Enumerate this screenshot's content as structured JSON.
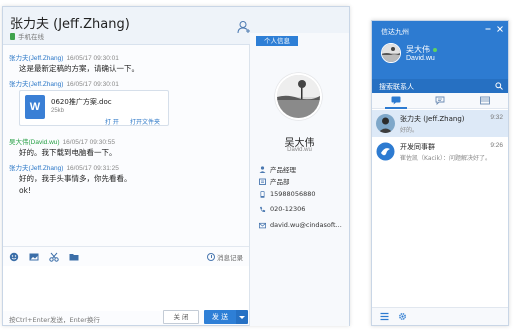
{
  "chat": {
    "contact_name": "张力夫 (Jeff.Zhang)",
    "contact_status": "手机在线",
    "profile_tab": "个人信息",
    "messages": [
      {
        "sender": "张力夫(Jeff.Zhang)",
        "time": "16/05/17 09:30:01",
        "text": "这是最新定稿的方案，请确认一下。"
      },
      {
        "sender": "张力夫(Jeff.Zhang)",
        "time": "16/05/17 09:30:01"
      },
      {
        "sender": "吴大伟(David.wu)",
        "time": "16/05/17 09:30:55",
        "text": "好的。我下载到电脑看一下。"
      },
      {
        "sender": "张力夫(Jeff.Zhang)",
        "time": "16/05/17 09:31:25",
        "text": "好的，我手头事情多，你先看看。"
      },
      {
        "text": "ok!"
      }
    ],
    "file": {
      "icon_letter": "W",
      "name": "0620推广方案.doc",
      "size": "25kb",
      "open_label": "打 开",
      "folder_label": "打开文件夹"
    },
    "history_label": "消息记录",
    "send_hint": "按Ctrl+Enter发送，Enter换行",
    "close_label": "关 闭",
    "send_label": "发 送"
  },
  "profile": {
    "name": "吴大伟",
    "en_name": "David.wu",
    "fields": [
      {
        "icon": "user-icon",
        "value": "产品经理"
      },
      {
        "icon": "department-icon",
        "value": "产品部"
      },
      {
        "icon": "mobile-icon",
        "value": "15988056880"
      },
      {
        "icon": "phone-icon",
        "value": "020-12306"
      },
      {
        "icon": "mail-icon",
        "value": "david.wu@cindasoft..."
      }
    ]
  },
  "contacts": {
    "app_name": "信达九州",
    "user_name": "吴大伟",
    "user_en": "David.wu",
    "search_label": "搜索联系人",
    "conversations": [
      {
        "name": "张力夫 (Jeff.Zhang)",
        "preview": "好的。",
        "time": "9:32",
        "active": true
      },
      {
        "name": "开发同事群",
        "preview": "崔佐凯（Kacik）：问题解决好了。",
        "time": "9:26",
        "active": false
      }
    ]
  },
  "colors": {
    "accent": "#2d7bd1",
    "online": "#5fd35f",
    "sender_blue": "#2b77c7",
    "sender_green": "#27a045"
  }
}
